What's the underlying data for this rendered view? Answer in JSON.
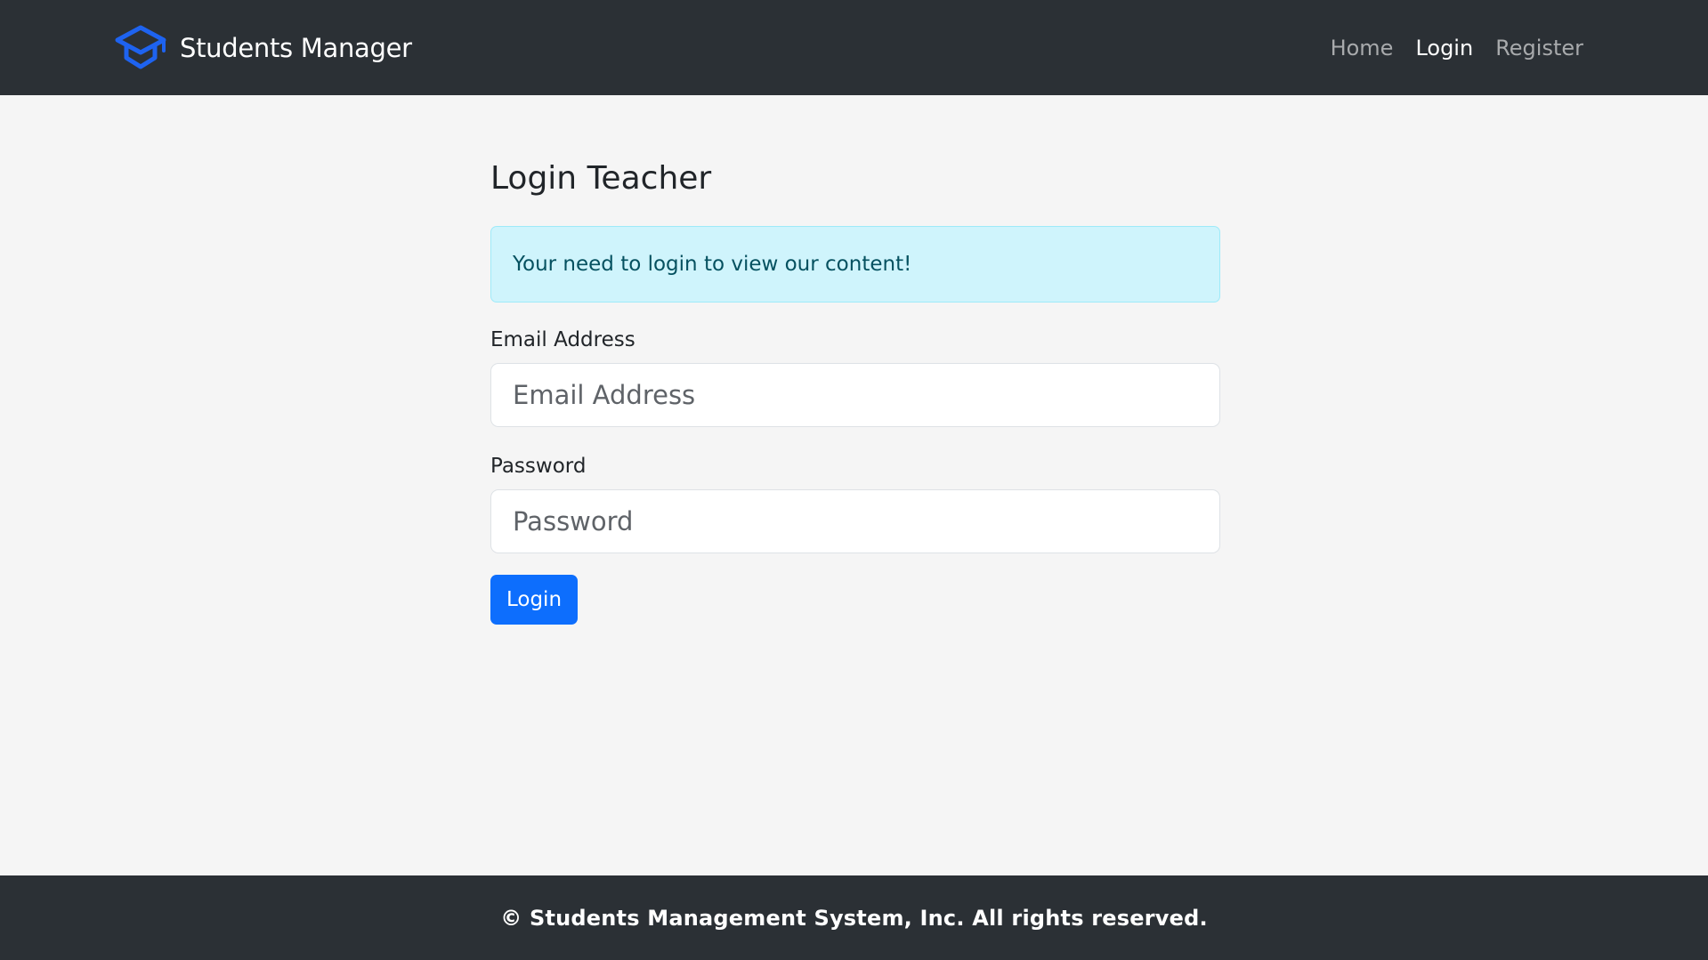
{
  "header": {
    "brand_name": "Students Manager",
    "brand_icon": "graduation-cap-icon",
    "nav": {
      "home": "Home",
      "login": "Login",
      "register": "Register"
    }
  },
  "main": {
    "title": "Login Teacher",
    "alert": "Your need to login to view our content!",
    "email": {
      "label": "Email Address",
      "placeholder": "Email Address",
      "value": ""
    },
    "password": {
      "label": "Password",
      "placeholder": "Password",
      "value": ""
    },
    "submit_label": "Login"
  },
  "footer": {
    "text": "© Students Management System, Inc. All rights reserved."
  },
  "colors": {
    "navbar_bg": "#2b3035",
    "page_bg": "#f5f5f5",
    "accent": "#0d6efd",
    "alert_bg": "#cff4fc",
    "alert_text": "#055160"
  }
}
